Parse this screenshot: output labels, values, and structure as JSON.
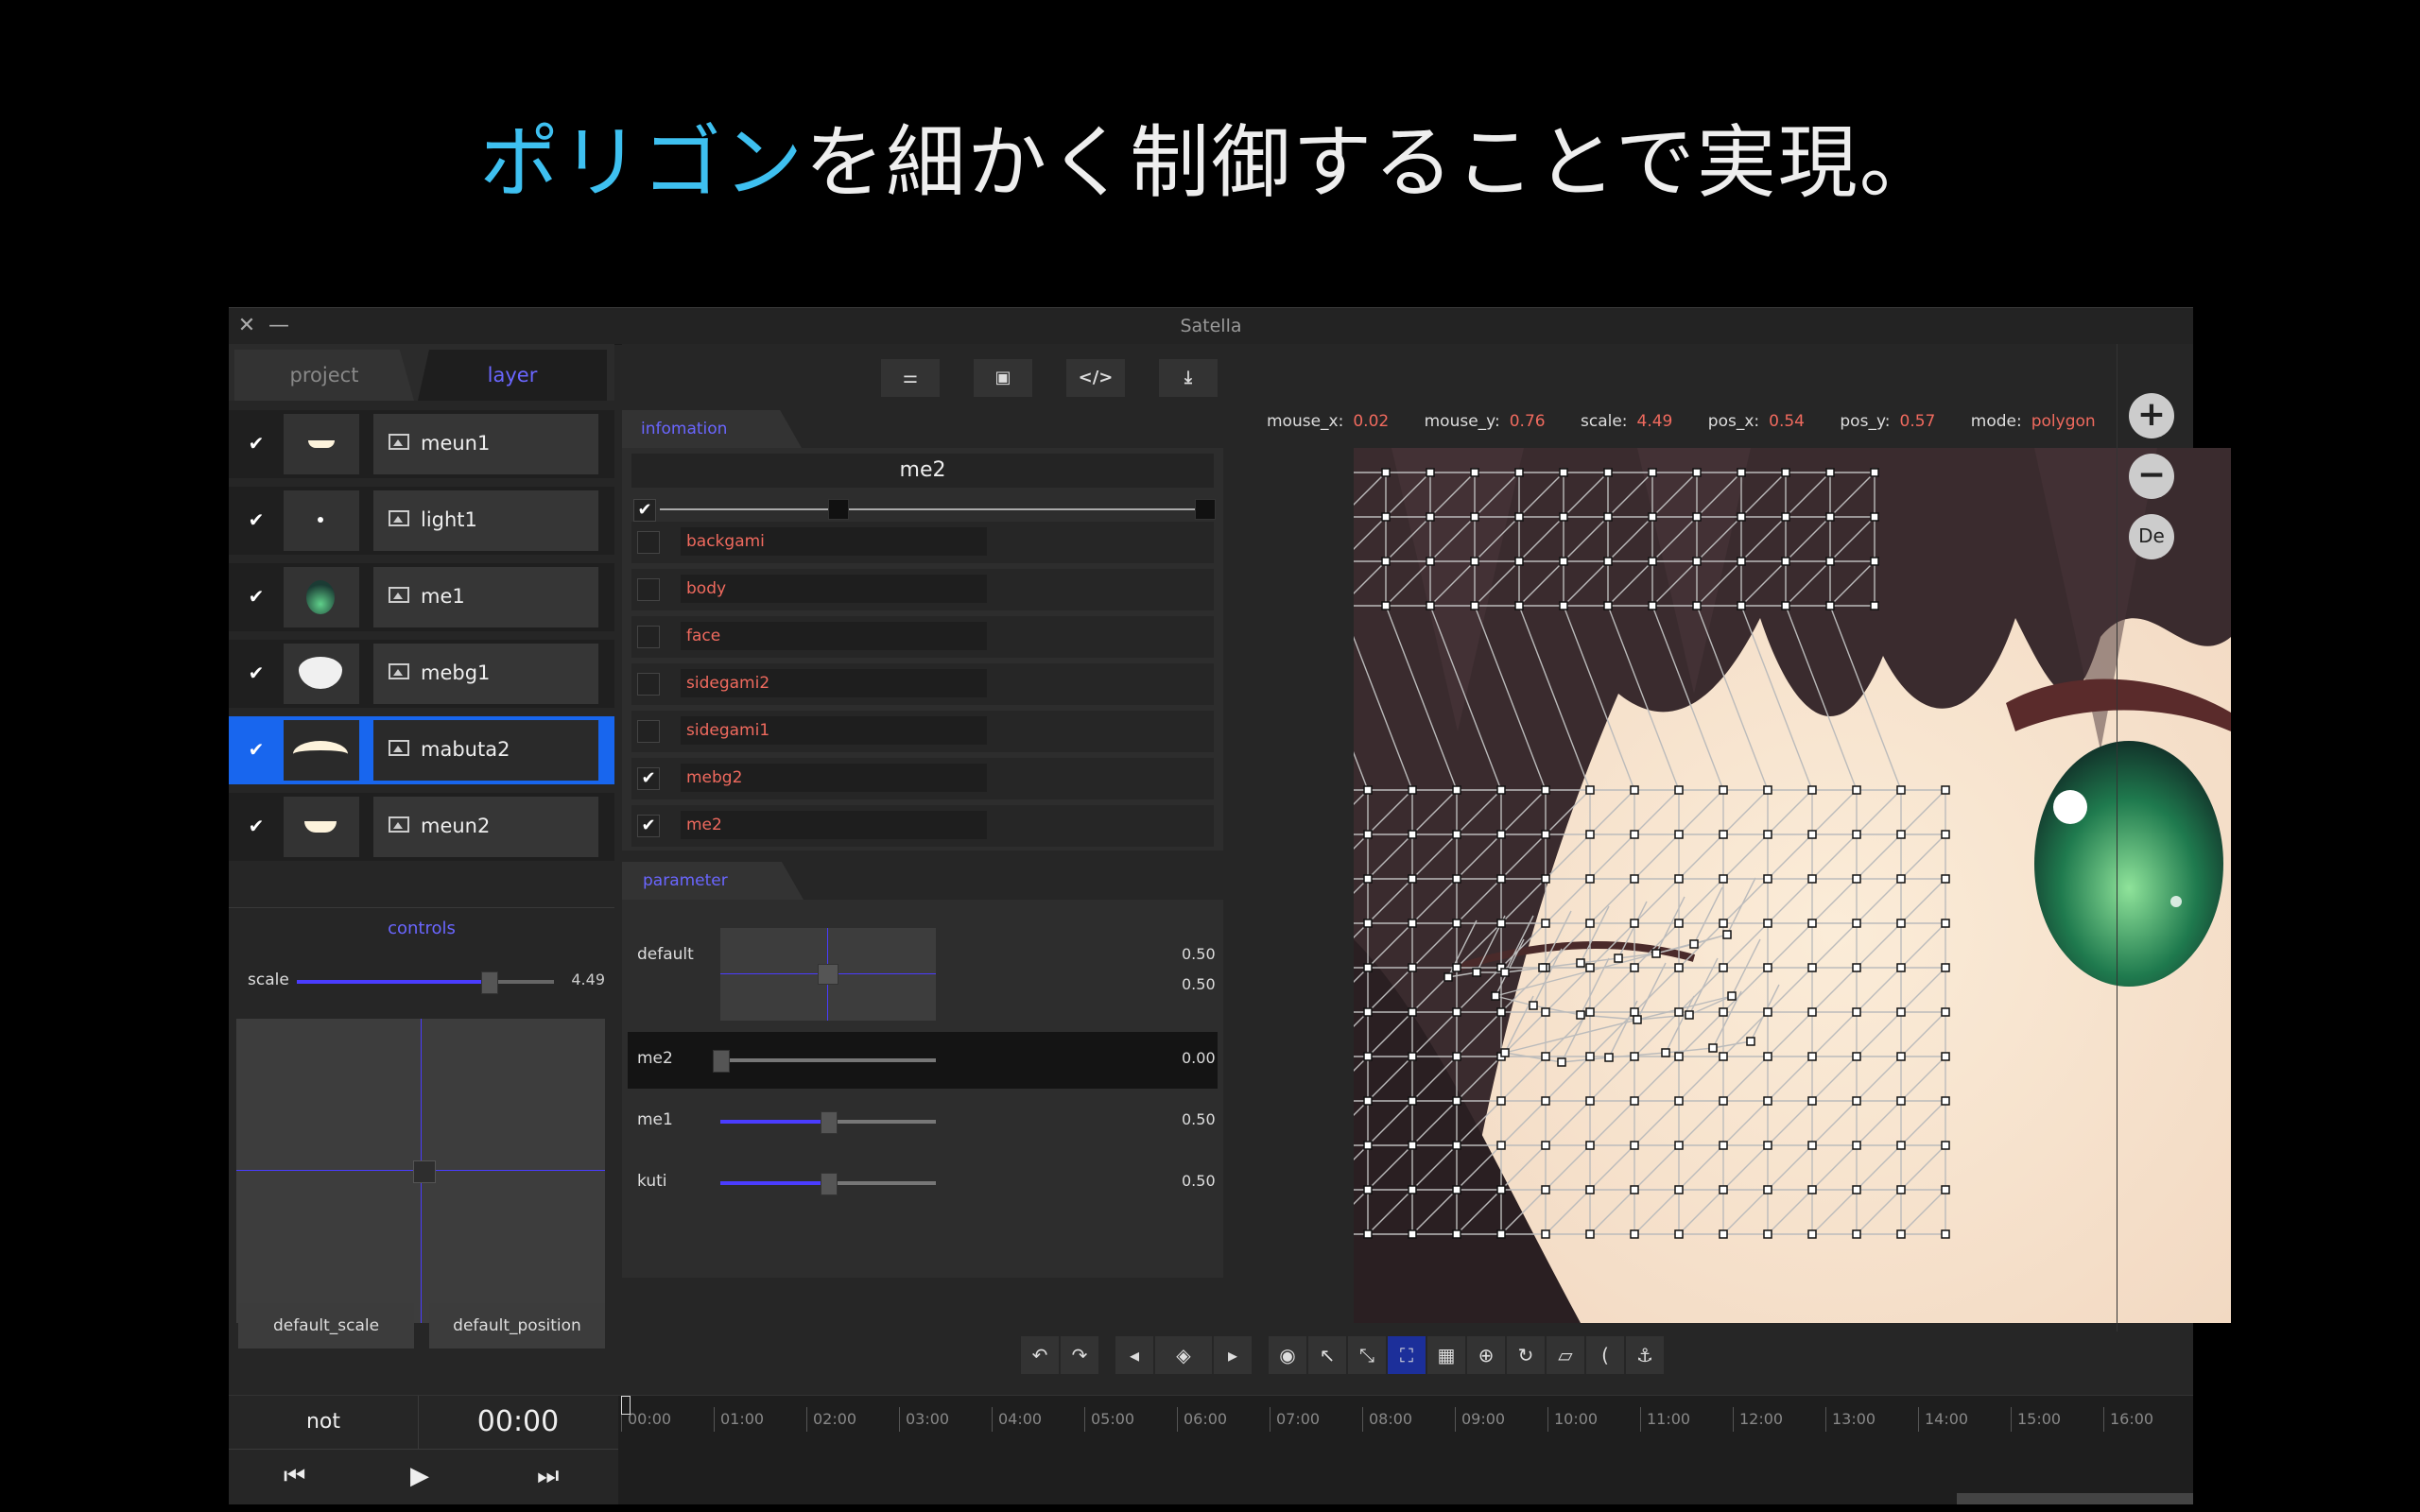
{
  "headline": {
    "accent": "ポリゴン",
    "rest": "を細かく制御することで実現。"
  },
  "window": {
    "title": "Satella"
  },
  "tabs": {
    "project": "project",
    "layer": "layer"
  },
  "layers": [
    {
      "name": "meun1",
      "checked": "✔"
    },
    {
      "name": "light1",
      "checked": "✔"
    },
    {
      "name": "me1",
      "checked": "✔"
    },
    {
      "name": "mebg1",
      "checked": "✔"
    },
    {
      "name": "mabuta2",
      "checked": "✔",
      "selected": true
    },
    {
      "name": "meun2",
      "checked": "✔"
    }
  ],
  "controls": {
    "header": "controls",
    "scale_label": "scale",
    "scale_value": "4.49",
    "default_scale": "default_scale",
    "default_position": "default_position"
  },
  "information": {
    "header": "infomation",
    "title": "me2",
    "meshes": [
      {
        "name": "backgami",
        "checked": ""
      },
      {
        "name": "body",
        "checked": ""
      },
      {
        "name": "face",
        "checked": ""
      },
      {
        "name": "sidegami2",
        "checked": ""
      },
      {
        "name": "sidegami1",
        "checked": ""
      },
      {
        "name": "mebg2",
        "checked": "✔"
      },
      {
        "name": "me2",
        "checked": "✔"
      }
    ]
  },
  "parameter": {
    "header": "parameter",
    "default_label": "default",
    "default_x": "0.50",
    "default_y": "0.50",
    "rows": [
      {
        "label": "me2",
        "value": "0.00",
        "level": 0.0
      },
      {
        "label": "me1",
        "value": "0.50",
        "level": 0.5
      },
      {
        "label": "kuti",
        "value": "0.50",
        "level": 0.5
      }
    ]
  },
  "status": {
    "mouse_x_label": "mouse_x:",
    "mouse_x": "0.02",
    "mouse_y_label": "mouse_y:",
    "mouse_y": "0.76",
    "scale_label": "scale:",
    "scale": "4.49",
    "pos_x_label": "pos_x:",
    "pos_x": "0.54",
    "pos_y_label": "pos_y:",
    "pos_y": "0.57",
    "mode_label": "mode:",
    "mode": "polygon"
  },
  "zoom": {
    "in": "+",
    "out": "−",
    "default": "De"
  },
  "toolbar_icons": [
    "sliders-icon",
    "image-icon",
    "code-icon",
    "export-icon"
  ],
  "toolbar_glyphs": {
    "sliders": "⚌",
    "image": "▣",
    "code": "</>",
    "export": "⤓"
  },
  "timeline": {
    "state": "not",
    "time": "00:00",
    "ticks": [
      "00:00",
      "01:00",
      "02:00",
      "03:00",
      "04:00",
      "05:00",
      "06:00",
      "07:00",
      "08:00",
      "09:00",
      "10:00",
      "11:00",
      "12:00",
      "13:00",
      "14:00",
      "15:00",
      "16:00"
    ],
    "prev": "⏮",
    "play": "▶",
    "next": "⏭"
  },
  "colors": {
    "accent": "#3ec0f0",
    "select": "#1866ee",
    "param": "#6a66ff",
    "value": "#f06a5e"
  }
}
